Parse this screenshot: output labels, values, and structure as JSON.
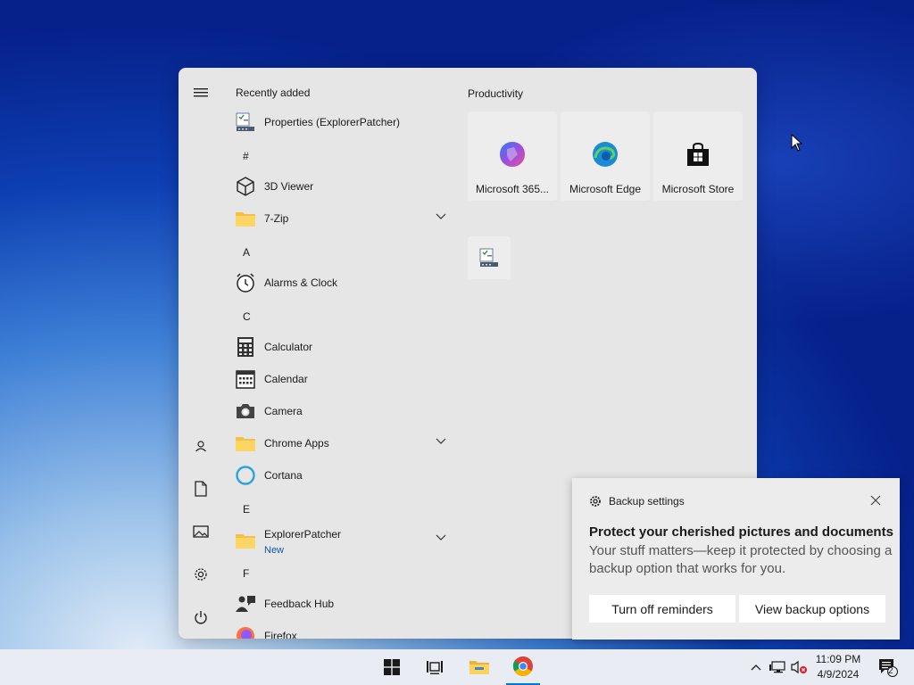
{
  "start_menu": {
    "recently_added_label": "Recently added",
    "apps": [
      {
        "label": "Properties (ExplorerPatcher)",
        "icon": "properties-icon"
      },
      {
        "letter": "#"
      },
      {
        "label": "3D Viewer",
        "icon": "cube-icon"
      },
      {
        "label": "7-Zip",
        "icon": "folder-icon",
        "expandable": true
      },
      {
        "letter": "A"
      },
      {
        "label": "Alarms & Clock",
        "icon": "clock-icon"
      },
      {
        "letter": "C"
      },
      {
        "label": "Calculator",
        "icon": "calculator-icon"
      },
      {
        "label": "Calendar",
        "icon": "calendar-icon"
      },
      {
        "label": "Camera",
        "icon": "camera-icon"
      },
      {
        "label": "Chrome Apps",
        "icon": "folder-icon",
        "expandable": true
      },
      {
        "label": "Cortana",
        "icon": "cortana-icon"
      },
      {
        "letter": "E"
      },
      {
        "label": "ExplorerPatcher",
        "sub": "New",
        "icon": "folder-icon",
        "expandable": true
      },
      {
        "letter": "F"
      },
      {
        "label": "Feedback Hub",
        "icon": "feedback-icon"
      },
      {
        "label": "Firefox",
        "icon": "firefox-icon"
      }
    ],
    "tiles_group": "Productivity",
    "tiles": [
      {
        "label": "Microsoft 365...",
        "icon": "m365-icon"
      },
      {
        "label": "Microsoft Edge",
        "icon": "edge-icon"
      },
      {
        "label": "Microsoft Store",
        "icon": "store-icon"
      },
      {
        "label": "",
        "icon": "properties-icon"
      }
    ]
  },
  "toast": {
    "app_name": "Backup settings",
    "title": "Protect your cherished pictures and documents",
    "body": "Your stuff matters—keep it protected by choosing a backup option that works for you.",
    "button_primary": "Turn off reminders",
    "button_secondary": "View backup options"
  },
  "taskbar": {
    "time": "11:09 PM",
    "date": "4/9/2024",
    "notification_count": "2"
  },
  "colors": {
    "accent": "#0078d4",
    "menu_bg": "#e6e6e6",
    "link_blue": "#0b5cad"
  }
}
